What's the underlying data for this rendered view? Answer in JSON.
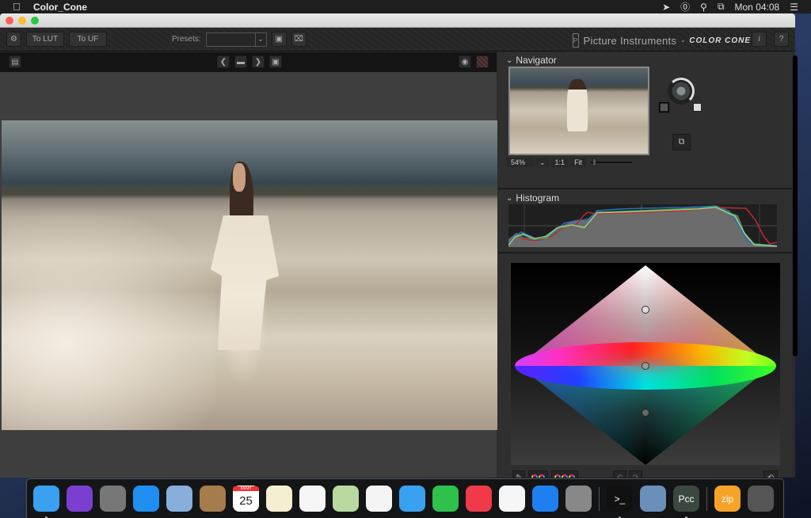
{
  "menubar": {
    "apple_icon": "apple-logo",
    "app_name": "Color_Cone",
    "status_icons": [
      "location-icon",
      "1password-icon",
      "spotlight-icon",
      "airplay-display-icon"
    ],
    "clock": "Mon 04:08",
    "notification_icon": "list-icon"
  },
  "toolbar": {
    "settings_icon": "⚙",
    "to_lut_label": "To LUT",
    "to_uf_label": "To UF",
    "presets_label": "Presets:",
    "presets_value": "",
    "save_icon": "💾",
    "delete_icon": "🗑",
    "brand_name": "Picture Instruments",
    "brand_dash": "-",
    "product_name": "COLOR CONE",
    "info_label": "i",
    "help_label": "?"
  },
  "viewer_toolbar": {
    "clipboard_icon": "clipboard-icon",
    "prev_label": "❮",
    "folder_icon": "folder-icon",
    "next_label": "❯",
    "save_icon": "save-icon",
    "eye_icon": "eye-icon",
    "clipping_icon": "clipping-icon"
  },
  "navigator": {
    "title": "Navigator",
    "zoom": "54%",
    "one_to_one": "1:1",
    "fit": "Fit",
    "zoom_slider_value": 0.05
  },
  "histogram": {
    "title": "Histogram",
    "colors": {
      "red": "#c0282e",
      "green": "#3fbf4a",
      "blue": "#2a6cc6",
      "luma": "#d8d8b0"
    }
  },
  "cone_tools": {
    "undo_label": "↶",
    "redo_label": "↷",
    "reset_label": "⟲"
  },
  "dock": {
    "apps": [
      {
        "name": "Finder",
        "running": true,
        "color": "#3aa0f0"
      },
      {
        "name": "Siri",
        "running": false,
        "color": "#7a3fd0"
      },
      {
        "name": "Launchpad",
        "running": false,
        "color": "#777"
      },
      {
        "name": "Safari",
        "running": false,
        "color": "#1f8ef0"
      },
      {
        "name": "Mail",
        "running": false,
        "color": "#88aedb"
      },
      {
        "name": "Contacts",
        "running": false,
        "color": "#a67c4d"
      },
      {
        "name": "Calendar",
        "running": false,
        "color": "#ffffff",
        "label": "25",
        "sub": "MAR"
      },
      {
        "name": "Notes",
        "running": false,
        "color": "#f4efd0"
      },
      {
        "name": "Reminders",
        "running": false,
        "color": "#f5f5f5"
      },
      {
        "name": "Maps",
        "running": false,
        "color": "#b8d8a0"
      },
      {
        "name": "Photos",
        "running": false,
        "color": "#f4f4f4"
      },
      {
        "name": "Messages",
        "running": false,
        "color": "#3aa0f0"
      },
      {
        "name": "FaceTime",
        "running": false,
        "color": "#2ec24d"
      },
      {
        "name": "News",
        "running": false,
        "color": "#f03a4a"
      },
      {
        "name": "iTunes",
        "running": false,
        "color": "#f5f5f5"
      },
      {
        "name": "App Store",
        "running": false,
        "color": "#1e7ff0"
      },
      {
        "name": "System Preferences",
        "running": false,
        "color": "#888"
      }
    ],
    "recent": [
      {
        "name": "Terminal",
        "running": true,
        "color": "#111",
        "label": ">_"
      },
      {
        "name": "Preview",
        "running": false,
        "color": "#6a8fb8"
      },
      {
        "name": "Color Cone",
        "running": true,
        "color": "#3a4840",
        "label": "Pcc"
      }
    ],
    "stacks": [
      {
        "name": "Downloads zip",
        "color": "#f6a329",
        "label": "zip"
      },
      {
        "name": "Trash",
        "color": "#555"
      }
    ]
  }
}
